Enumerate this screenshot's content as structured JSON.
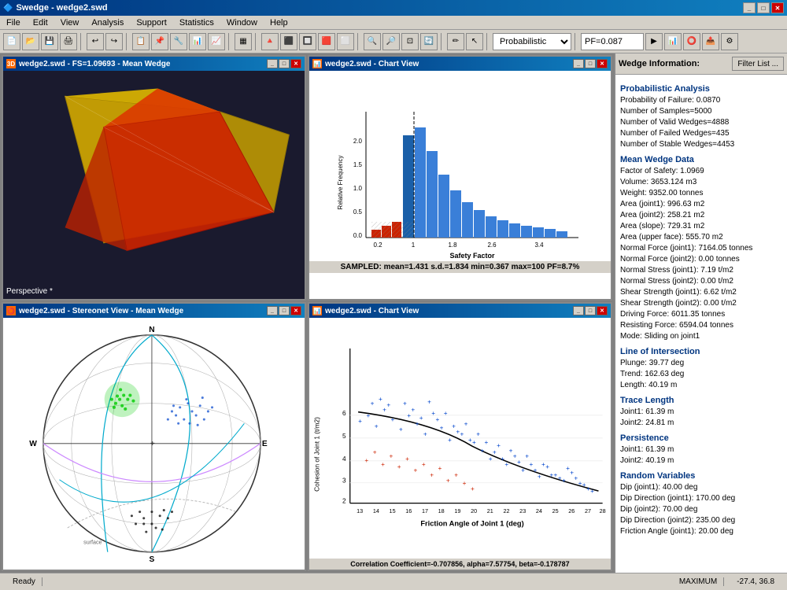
{
  "app": {
    "title": "Swedge - wedge2.swd",
    "title_icon": "SW"
  },
  "menu": {
    "items": [
      "File",
      "Edit",
      "View",
      "Analysis",
      "Support",
      "Statistics",
      "Window",
      "Help"
    ]
  },
  "toolbar": {
    "dropdown_value": "Probabilistic",
    "pf_value": "PF=0.087"
  },
  "panels": {
    "panel1": {
      "title": "wedge2.swd - FS=1.09693 - Mean Wedge",
      "label": "Perspective *"
    },
    "panel2": {
      "title": "wedge2.swd - Chart View",
      "caption": "SAMPLED: mean=1.431 s.d.=1.834 min=0.367 max=100 PF=8.7%",
      "x_label": "Safety Factor",
      "y_label": "Relative Frequency"
    },
    "panel3": {
      "title": "wedge2.swd - Stereonet View - Mean Wedge"
    },
    "panel4": {
      "title": "wedge2.swd - Chart View",
      "caption": "Correlation Coefficient=-0.707856, alpha=7.57754, beta=-0.178787",
      "x_label": "Friction Angle of Joint 1 (deg)",
      "y_label": "Cohesion of Joint 1 (t/m2)"
    }
  },
  "sidebar": {
    "header_label": "Wedge Information:",
    "filter_btn": "Filter List ...",
    "sections": [
      {
        "title": "Probabilistic Analysis",
        "lines": [
          "Probability of Failure: 0.0870",
          "Number of Samples=5000",
          "Number of Valid Wedges=4888",
          "Number of Failed Wedges=435",
          "Number of Stable Wedges=4453"
        ]
      },
      {
        "title": "Mean Wedge Data",
        "lines": [
          "Factor of Safety: 1.0969",
          "Volume: 3653.124 m3",
          "Weight: 9352.00 tonnes",
          "Area (joint1): 996.63 m2",
          "Area (joint2): 258.21 m2",
          "Area (slope): 729.31 m2",
          "Area (upper face): 555.70 m2",
          "Normal Force (joint1): 7164.05 tonnes",
          "Normal Force (joint2): 0.00 tonnes",
          "Normal Stress (joint1): 7.19 t/m2",
          "Normal Stress (joint2): 0.00 t/m2",
          "Shear Strength (joint1): 6.62 t/m2",
          "Shear Strength (joint2): 0.00 t/m2",
          "Driving Force: 6011.35 tonnes",
          "Resisting Force: 6594.04 tonnes",
          "Mode: Sliding on joint1"
        ]
      },
      {
        "title": "Line of Intersection",
        "lines": [
          "Plunge: 39.77 deg",
          "Trend: 162.63 deg",
          "Length: 40.19 m"
        ]
      },
      {
        "title": "Trace Length",
        "lines": [
          "Joint1: 61.39 m",
          "Joint2: 24.81 m"
        ]
      },
      {
        "title": "Persistence",
        "lines": [
          "Joint1: 61.39 m",
          "Joint2: 40.19 m"
        ]
      },
      {
        "title": "Random Variables",
        "lines": [
          "Dip (joint1): 40.00 deg",
          "Dip Direction (joint1): 170.00 deg",
          "Dip (joint2): 70.00 deg",
          "Dip Direction (joint2): 235.00 deg",
          "Friction Angle (joint1): 20.00 deg"
        ]
      }
    ]
  },
  "status": {
    "left": "Ready",
    "middle": "MAXIMUM",
    "right": "-27.4, 36.8"
  }
}
